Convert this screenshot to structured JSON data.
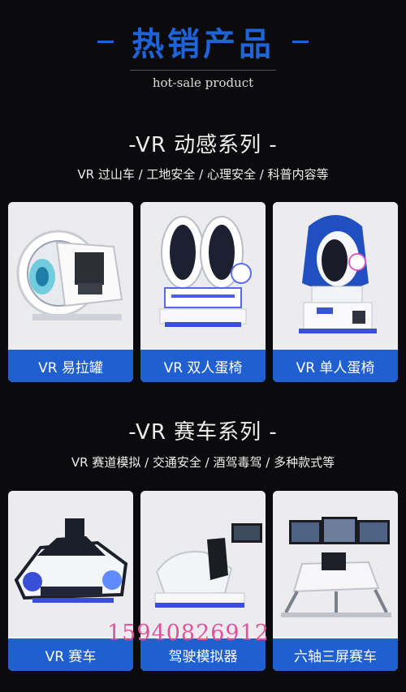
{
  "header": {
    "title": "热销产品",
    "subtitle": "hot-sale product"
  },
  "section1": {
    "title": "-VR 动感系列 -",
    "desc": "VR 过山车 / 工地安全 / 心理安全 / 科普内容等",
    "cards": [
      {
        "label": "VR 易拉罐",
        "icon": "vr-can-machine"
      },
      {
        "label": "VR 双人蛋椅",
        "icon": "vr-double-egg-chair"
      },
      {
        "label": "VR 单人蛋椅",
        "icon": "vr-single-egg-chair"
      }
    ]
  },
  "section2": {
    "title": "-VR 赛车系列 -",
    "desc": "VR 赛道模拟 / 交通安全 / 酒驾毒驾 / 多种款式等",
    "cards": [
      {
        "label": "VR 赛车",
        "icon": "vr-racing-car"
      },
      {
        "label": "驾驶模拟器",
        "icon": "driving-simulator"
      },
      {
        "label": "六轴三屏赛车",
        "icon": "six-axis-triple-screen-racer"
      }
    ]
  },
  "overlay": {
    "phone": "15940826912"
  },
  "colors": {
    "accent": "#1f5fcf",
    "background": "#0b0b0d",
    "phone": "#e0529c"
  }
}
